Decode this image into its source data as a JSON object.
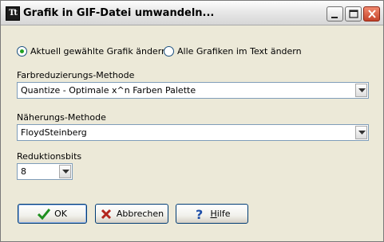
{
  "window": {
    "title": "Grafik in GIF-Datei umwandeln...",
    "app_icon_text": "Tt",
    "controls": [
      "minimize-icon",
      "maximize-icon",
      "close-icon"
    ]
  },
  "scope": {
    "options": [
      {
        "label": "Aktuell gewählte Grafik ändern",
        "checked": true
      },
      {
        "label": "Alle Grafiken im Text ändern",
        "checked": false
      }
    ]
  },
  "color_reduction": {
    "label": "Farbreduzierungs-Methode",
    "value": "Quantize -  Optimale x^n Farben Palette"
  },
  "approximation": {
    "label": "Näherungs-Methode",
    "value": "FloydSteinberg"
  },
  "reduction_bits": {
    "label": "Reduktionsbits",
    "value": "8"
  },
  "buttons": {
    "ok": "OK",
    "cancel": "Abbrechen",
    "help_prefix": "",
    "help_mnemonic": "H",
    "help_rest": "ilfe"
  },
  "colors": {
    "dialog_bg": "#ece9d8",
    "field_border": "#7f9db9",
    "radio_dot": "#21a121",
    "close_button": "#c5432a"
  }
}
